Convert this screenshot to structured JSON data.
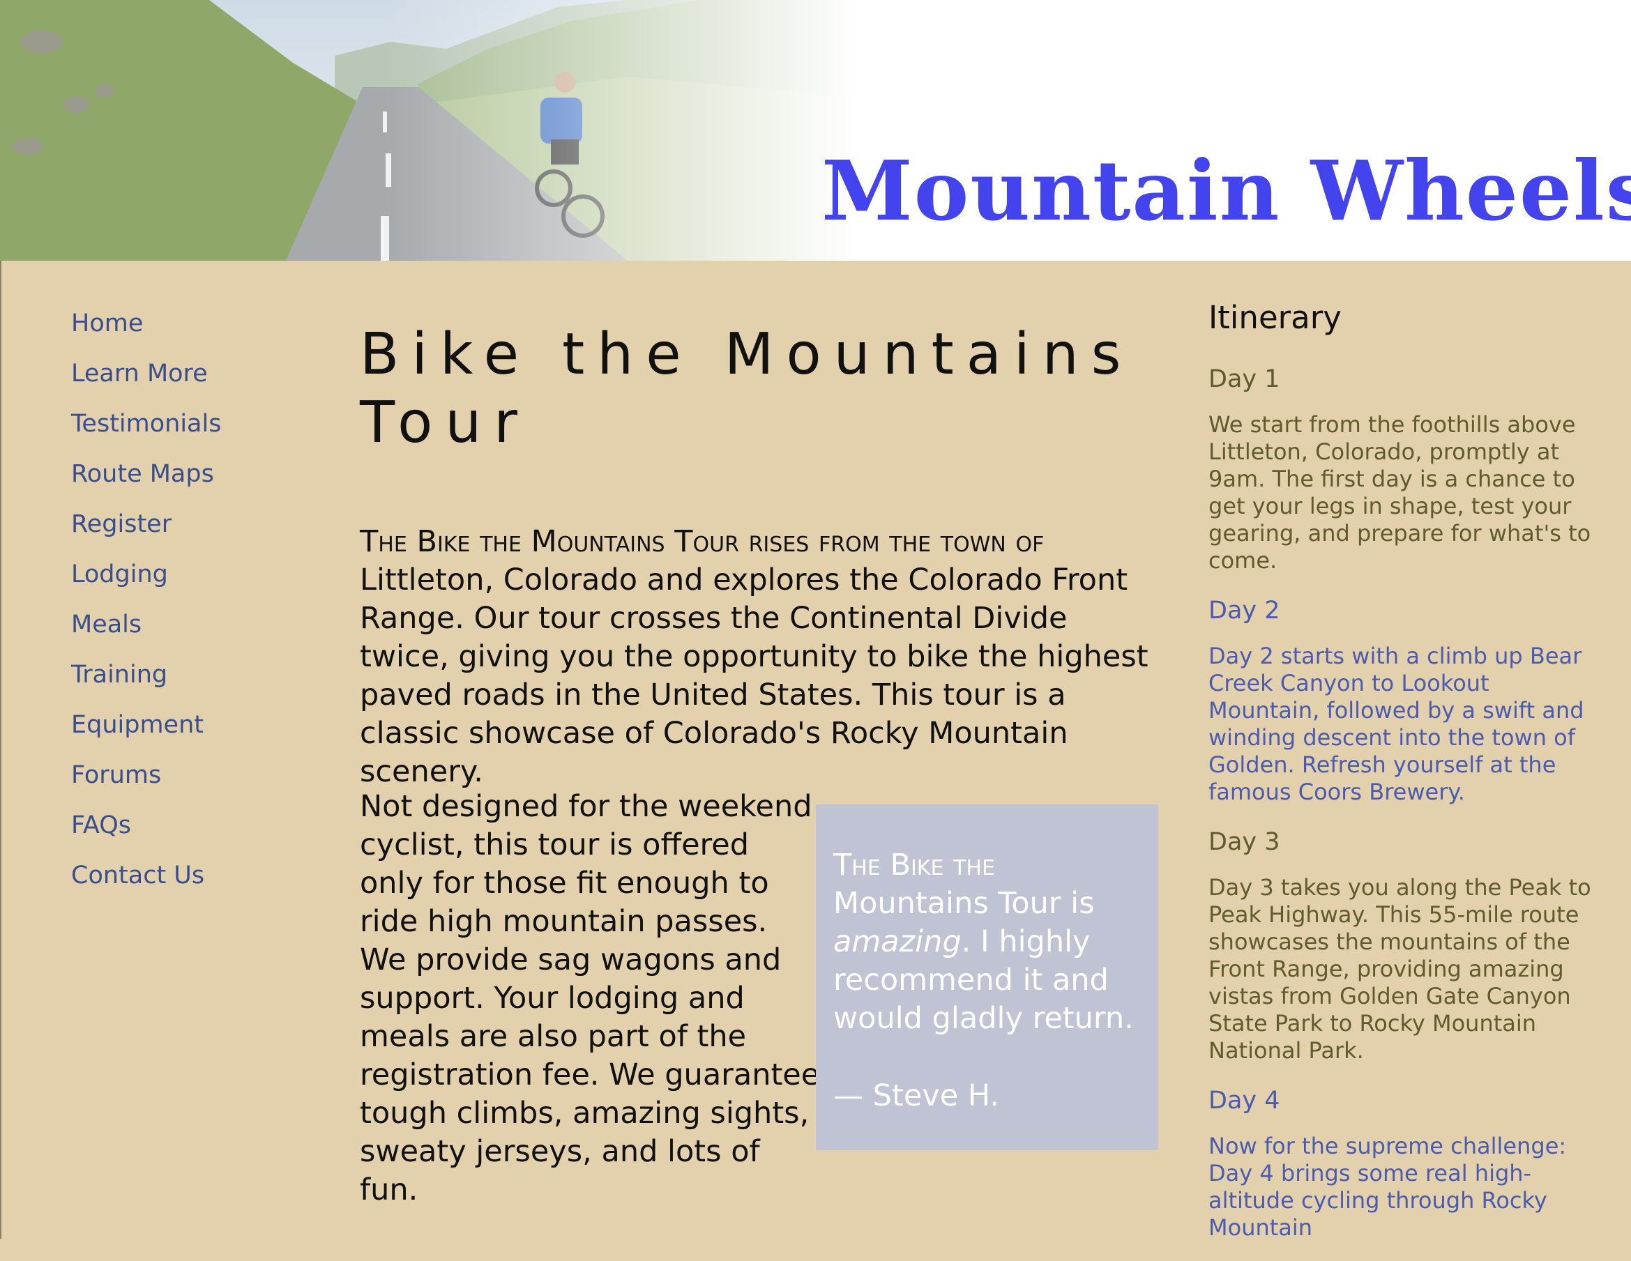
{
  "site": {
    "title": "Mountain Wheels"
  },
  "nav": {
    "items": [
      {
        "label": "Home"
      },
      {
        "label": "Learn More"
      },
      {
        "label": "Testimonials"
      },
      {
        "label": "Route Maps"
      },
      {
        "label": "Register"
      },
      {
        "label": "Lodging"
      },
      {
        "label": "Meals"
      },
      {
        "label": "Training"
      },
      {
        "label": "Equipment"
      },
      {
        "label": "Forums"
      },
      {
        "label": "FAQs"
      },
      {
        "label": "Contact Us"
      }
    ]
  },
  "main": {
    "title": "Bike the Mountains Tour",
    "intro_lead": "The Bike the Mountains Tour rises from the town of",
    "intro_rest": "Littleton, Colorado and explores the Colorado Front Range. Our tour crosses the Continental Divide twice, giving you the opportunity to bike the highest paved roads in the United States. This tour is a classic showcase of Colorado's Rocky Mountain scenery.",
    "paragraph2": "Not designed for the weekend cyclist, this tour is offered only for those fit enough to ride high mountain passes. We provide sag wagons and support. Your lodging and meals are also part of the registration fee. We guarantee tough climbs, amazing sights, sweaty jerseys, and lots of fun.",
    "quote": {
      "lead": "The Bike the",
      "text_before": "Mountains Tour is",
      "emphasis": "amazing",
      "text_after": ". I highly recommend it and would gladly return.",
      "author": "— Steve H."
    }
  },
  "aside": {
    "title": "Itinerary",
    "days": [
      {
        "title": "Day 1",
        "text": "We start from the foothills above Littleton, Colorado, promptly at 9am. The first day is a chance to get your legs in shape, test your gearing, and prepare for what's to come."
      },
      {
        "title": "Day 2",
        "text": "Day 2 starts with a climb up Bear Creek Canyon to Lookout Mountain, followed by a swift and winding descent into the town of Golden. Refresh yourself at the famous Coors Brewery."
      },
      {
        "title": "Day 3",
        "text": "Day 3 takes you along the Peak to Peak Highway. This 55-mile route showcases the mountains of the Front Range, providing amazing vistas from Golden Gate Canyon State Park to Rocky Mountain National Park."
      },
      {
        "title": "Day 4",
        "text": "Now for the supreme challenge: Day 4 brings some real high-altitude cycling through Rocky Mountain"
      }
    ]
  },
  "colors": {
    "page_background": "#e3d1ad",
    "title_blue": "#4444ee",
    "nav_link": "#3a4f8a",
    "day_olive": "#5f5b2f",
    "day_blue": "#4b5bb0",
    "quote_background": "#bfc3d3"
  }
}
